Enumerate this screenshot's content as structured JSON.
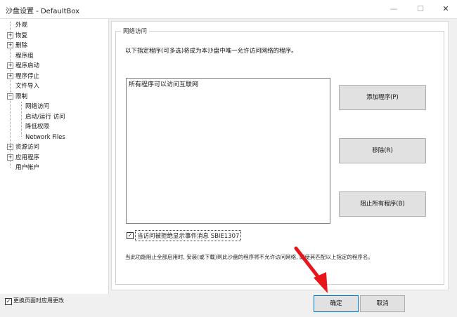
{
  "window": {
    "title": "沙盘设置 - DefaultBox",
    "min_icon": "minimize-icon",
    "max_icon": "maximize-icon",
    "close_icon": "close-icon"
  },
  "tree": {
    "items": [
      {
        "label": "外观",
        "expander": ""
      },
      {
        "label": "恢复",
        "expander": "+"
      },
      {
        "label": "删除",
        "expander": "+"
      },
      {
        "label": "程序组",
        "expander": ""
      },
      {
        "label": "程序启动",
        "expander": "+"
      },
      {
        "label": "程序停止",
        "expander": "+"
      },
      {
        "label": "文件导入",
        "expander": ""
      },
      {
        "label": "限制",
        "expander": "−"
      },
      {
        "label": "网络访问",
        "expander": ""
      },
      {
        "label": "启动/运行 访问",
        "expander": ""
      },
      {
        "label": "降低权限",
        "expander": ""
      },
      {
        "label": "Network Files",
        "expander": ""
      },
      {
        "label": "资源访问",
        "expander": "+"
      },
      {
        "label": "应用程序",
        "expander": "+"
      },
      {
        "label": "用户帐户",
        "expander": ""
      }
    ]
  },
  "panel": {
    "group_title": "网络访问",
    "description": "以下指定程序(可多选)将成为本沙盘中唯一允许访问网络的程序。",
    "list_items": [
      "所有程序可以访问互联网"
    ],
    "buttons": {
      "add": "添加程序(P)",
      "remove": "移除(R)",
      "block_all": "阻止所有程序(B)"
    },
    "notify_checkbox": {
      "label": "当访问被拒绝显示事件消息 SBIE1307",
      "checked": true,
      "mark": "✓"
    },
    "note": "当此功能阻止全部启用时, 安装(或下载)到此沙盘的程序将不允许访问网络, 即使其匹配以上指定的程序名。"
  },
  "footer": {
    "apply_checkbox": {
      "label": "更换页面时应用更改",
      "checked": true,
      "mark": "✓"
    },
    "ok": "确定",
    "cancel": "取消"
  },
  "colors": {
    "accent": "#0078d7",
    "arrow": "#e8161b"
  }
}
